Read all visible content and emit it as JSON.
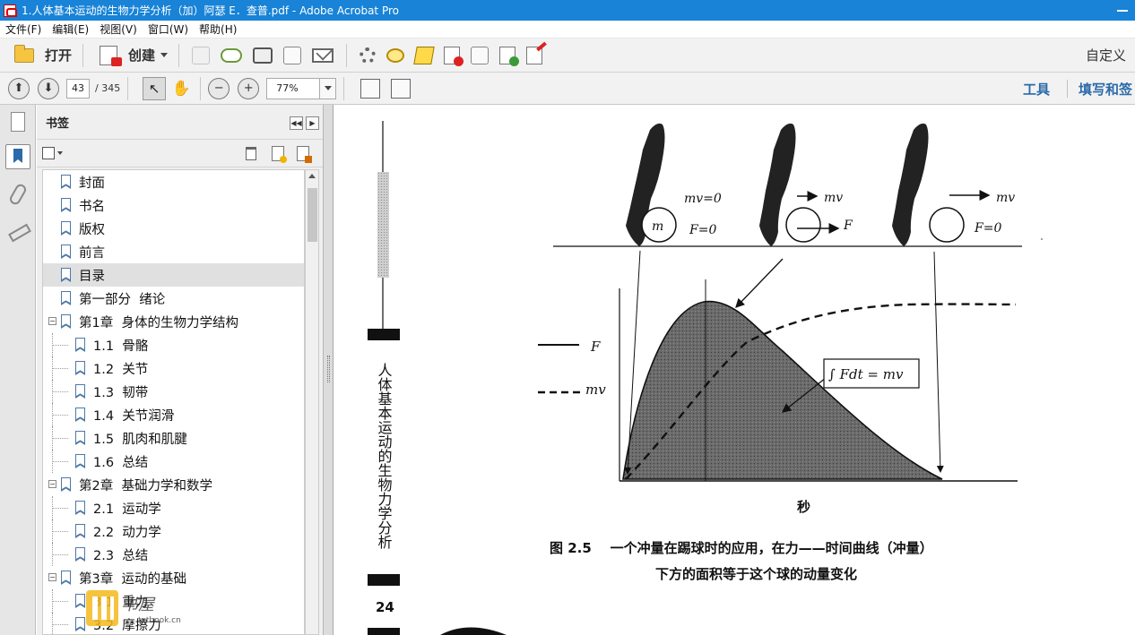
{
  "window": {
    "title": "1.人体基本运动的生物力学分析（加）阿瑟 E．查普.pdf - Adobe Acrobat Pro"
  },
  "menu": [
    "文件(F)",
    "编辑(E)",
    "视图(V)",
    "窗口(W)",
    "帮助(H)"
  ],
  "toolbar1": {
    "open_label": "打开",
    "create_label": "创建",
    "right_label": "自定义"
  },
  "toolbar2": {
    "page_current": "43",
    "page_total": "/ 345",
    "zoom": "77%",
    "tools_label": "工具",
    "fill_sign_label": "填写和签"
  },
  "bookmarks_panel": {
    "title": "书签",
    "items": [
      {
        "label": "封面",
        "level": 0
      },
      {
        "label": "书名",
        "level": 0
      },
      {
        "label": "版权",
        "level": 0
      },
      {
        "label": "前言",
        "level": 0
      },
      {
        "label": "目录",
        "level": 0,
        "selected": true
      },
      {
        "label": "第一部分  绪论",
        "level": 0
      },
      {
        "label": "第1章  身体的生物力学结构",
        "level": 0,
        "expandable": true
      },
      {
        "label": "1.1  骨骼",
        "level": 1
      },
      {
        "label": "1.2  关节",
        "level": 1
      },
      {
        "label": "1.3  韧带",
        "level": 1
      },
      {
        "label": "1.4  关节润滑",
        "level": 1
      },
      {
        "label": "1.5  肌肉和肌腱",
        "level": 1
      },
      {
        "label": "1.6  总结",
        "level": 1
      },
      {
        "label": "第2章  基础力学和数学",
        "level": 0,
        "expandable": true
      },
      {
        "label": "2.1  运动学",
        "level": 1
      },
      {
        "label": "2.2  动力学",
        "level": 1
      },
      {
        "label": "2.3  总结",
        "level": 1
      },
      {
        "label": "第3章  运动的基础",
        "level": 0,
        "expandable": true
      },
      {
        "label": "3.1  重力",
        "level": 1
      },
      {
        "label": "3.2  摩擦力",
        "level": 1
      }
    ]
  },
  "document": {
    "side_title": "人体基本运动的生物力学分析",
    "page_number": "24",
    "figure": {
      "labels_top": {
        "mv0": "mv=0",
        "f0a": "F=0",
        "m": "m",
        "mv_mid": "mv",
        "f_mid": "F",
        "mv_right": "mv",
        "f0b": "F=0"
      },
      "legend_f": "F",
      "legend_mv": "mv",
      "integral": "∫ Fdt = mv",
      "xlabel": "秒",
      "caption_line1": "图 2.5    一个冲量在踢球时的应用，在力——时间曲线（冲量）",
      "caption_line2": "下方的面积等于这个球的动量变化"
    }
  },
  "watermark": {
    "text": "书屋",
    "url": "txtbook.cn"
  }
}
